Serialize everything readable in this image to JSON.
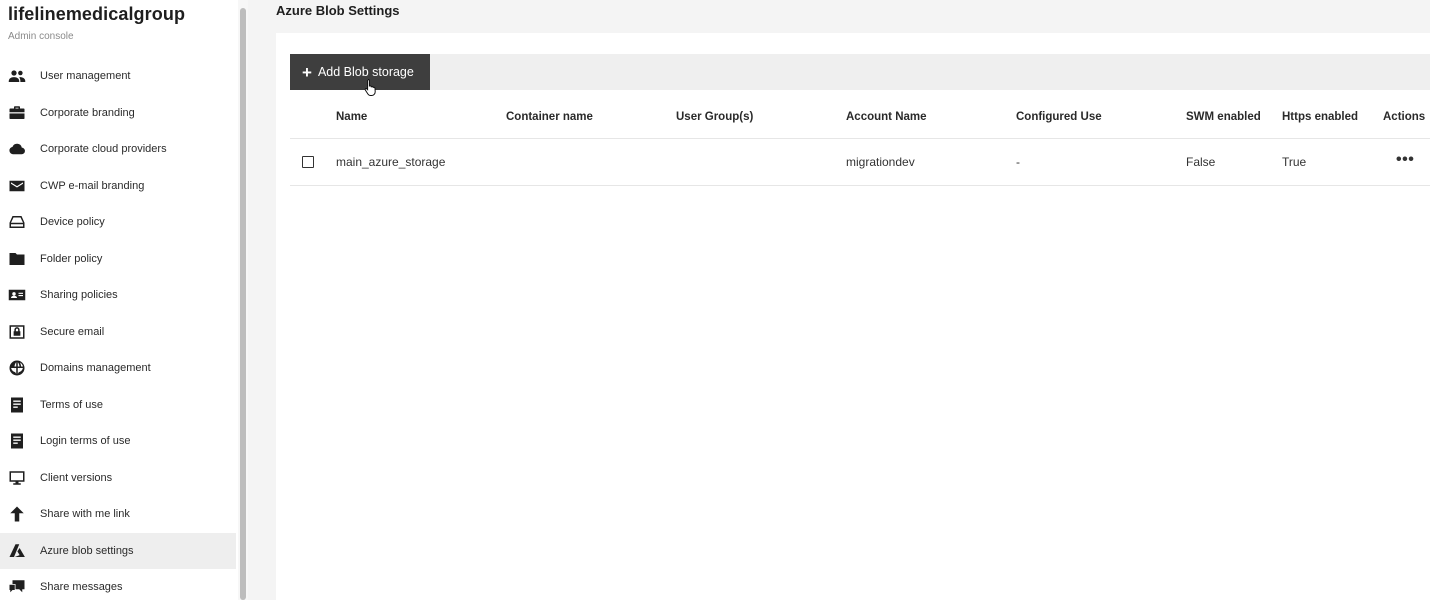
{
  "brand": {
    "title": "lifelinemedicalgroup",
    "subtitle": "Admin console"
  },
  "sidebar": {
    "items": [
      {
        "label": "User management",
        "icon": "users-icon"
      },
      {
        "label": "Corporate branding",
        "icon": "briefcase-icon"
      },
      {
        "label": "Corporate cloud providers",
        "icon": "cloud-icon"
      },
      {
        "label": "CWP e-mail branding",
        "icon": "envelope-icon"
      },
      {
        "label": "Device policy",
        "icon": "drive-icon"
      },
      {
        "label": "Folder policy",
        "icon": "folder-icon"
      },
      {
        "label": "Sharing policies",
        "icon": "contact-card-icon"
      },
      {
        "label": "Secure email",
        "icon": "secure-mail-icon"
      },
      {
        "label": "Domains management",
        "icon": "globe-icon"
      },
      {
        "label": "Terms of use",
        "icon": "document-icon"
      },
      {
        "label": "Login terms of use",
        "icon": "document-icon"
      },
      {
        "label": "Client versions",
        "icon": "monitor-icon"
      },
      {
        "label": "Share with me link",
        "icon": "arrow-up-icon"
      },
      {
        "label": "Azure blob settings",
        "icon": "azure-icon",
        "active": true
      },
      {
        "label": "Share messages",
        "icon": "chat-icon"
      }
    ]
  },
  "main": {
    "title": "Azure Blob Settings",
    "add_button": {
      "icon": "plus-icon",
      "label": "Add Blob storage"
    },
    "table": {
      "columns": [
        "Name",
        "Container name",
        "User Group(s)",
        "Account Name",
        "Configured Use",
        "SWM enabled",
        "Https enabled",
        "Actions"
      ],
      "rows": [
        {
          "name": "main_azure_storage",
          "container": "",
          "user_groups": "",
          "account": "migrationdev",
          "configured_use": "-",
          "swm": "False",
          "https": "True",
          "actions_icon": "more-horizontal-icon"
        }
      ]
    }
  }
}
